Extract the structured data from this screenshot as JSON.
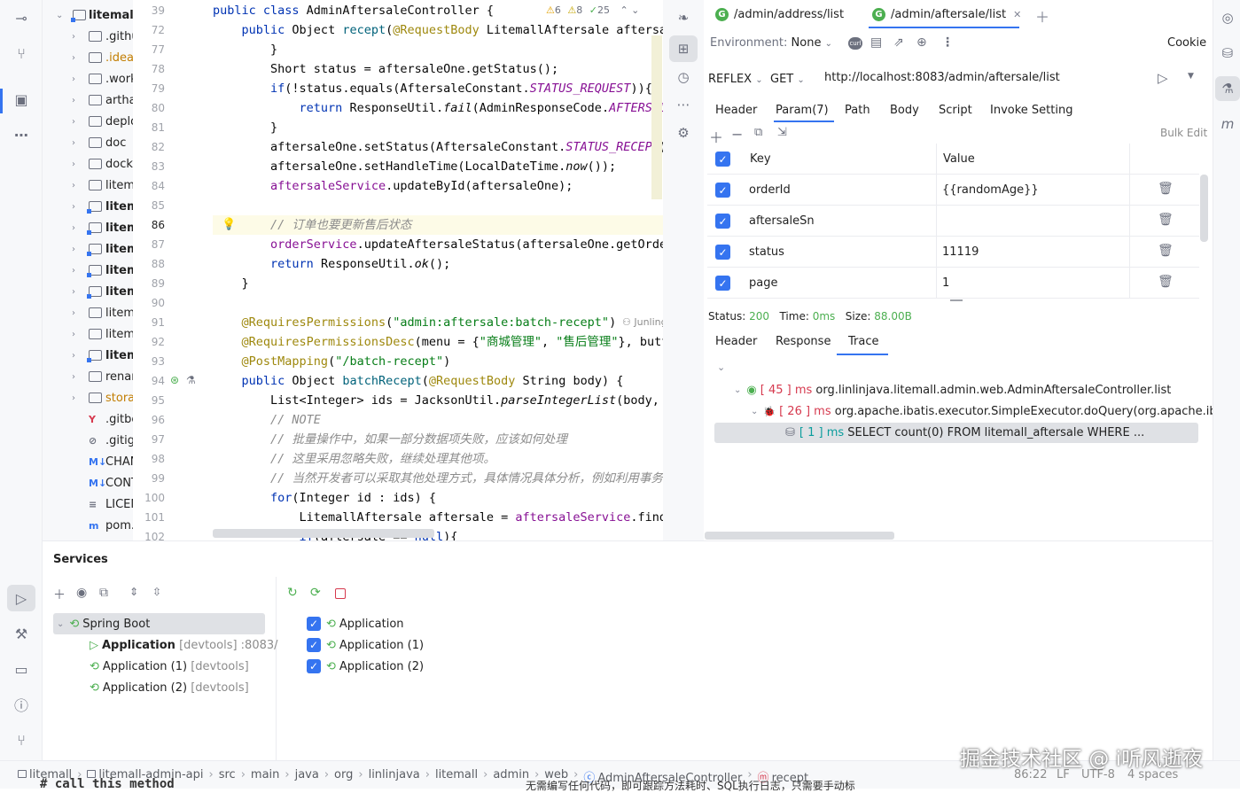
{
  "project_tree": {
    "root": "litemall",
    "items": [
      {
        "label": ".githu",
        "type": "folder",
        "mod": false,
        "bold": false
      },
      {
        "label": ".idea",
        "type": "folder",
        "mod": false,
        "bold": false,
        "color": "#c27d00"
      },
      {
        "label": ".work",
        "type": "folder",
        "mod": false,
        "bold": false
      },
      {
        "label": "artha",
        "type": "folder",
        "mod": false,
        "bold": false
      },
      {
        "label": "deplo",
        "type": "folder",
        "mod": false,
        "bold": false
      },
      {
        "label": "doc",
        "type": "folder",
        "mod": false,
        "bold": false
      },
      {
        "label": "dock",
        "type": "folder",
        "mod": false,
        "bold": false
      },
      {
        "label": "litem",
        "type": "folder",
        "mod": false,
        "bold": false
      },
      {
        "label": "litem",
        "type": "folder",
        "mod": true,
        "bold": true
      },
      {
        "label": "litem",
        "type": "folder",
        "mod": true,
        "bold": true
      },
      {
        "label": "litem",
        "type": "folder",
        "mod": true,
        "bold": true
      },
      {
        "label": "litem",
        "type": "folder",
        "mod": true,
        "bold": true
      },
      {
        "label": "litem",
        "type": "folder",
        "mod": true,
        "bold": true
      },
      {
        "label": "litem",
        "type": "folder",
        "mod": false,
        "bold": false
      },
      {
        "label": "litem",
        "type": "folder",
        "mod": false,
        "bold": false
      },
      {
        "label": "litem",
        "type": "folder",
        "mod": true,
        "bold": true
      },
      {
        "label": "renar",
        "type": "folder",
        "mod": false,
        "bold": false
      },
      {
        "label": "stora",
        "type": "folder",
        "mod": false,
        "bold": false,
        "color": "#c27d00"
      },
      {
        "label": ".gitbc",
        "type": "file",
        "icon": "Y",
        "iconcolor": "#d6394e"
      },
      {
        "label": ".gitig",
        "type": "file",
        "icon": "⊘",
        "iconcolor": "#6c707e"
      },
      {
        "label": "CHAN",
        "type": "file",
        "icon": "M↓",
        "iconcolor": "#3574f0"
      },
      {
        "label": "CONT",
        "type": "file",
        "icon": "M↓",
        "iconcolor": "#3574f0"
      },
      {
        "label": "LICEN",
        "type": "file",
        "icon": "≡",
        "iconcolor": "#6c707e"
      },
      {
        "label": "pom.",
        "type": "file",
        "icon": "m",
        "iconcolor": "#3574f0"
      }
    ]
  },
  "editor": {
    "inspection": {
      "warnings": "6",
      "weak": "8",
      "ok": "25"
    },
    "lines": [
      {
        "n": "39",
        "html": "<span class='kw'>public class</span> AdminAftersaleController {"
      },
      {
        "n": "72",
        "html": "    <span class='kw'>public</span> Object <span class='meth'>recept</span>(<span class='ann'>@RequestBody</span> LitemallAftersale aftersa"
      },
      {
        "n": "77",
        "html": "        }"
      },
      {
        "n": "78",
        "html": "        Short status = aftersaleOne.getStatus();"
      },
      {
        "n": "79",
        "html": "        <span class='kw'>if</span>(!status.equals(AftersaleConstant.<span class='fld it'>STATUS_REQUEST</span>)){"
      },
      {
        "n": "80",
        "html": "            <span class='kw'>return</span> ResponseUtil.<span class='it'>fail</span>(AdminResponseCode.<span class='fld it'>AFTERSALE</span>"
      },
      {
        "n": "81",
        "html": "        }"
      },
      {
        "n": "82",
        "html": "        aftersaleOne.setStatus(AftersaleConstant.<span class='fld it'>STATUS_RECEPT</span>)"
      },
      {
        "n": "83",
        "html": "        aftersaleOne.setHandleTime(LocalDateTime.<span class='it'>now</span>());"
      },
      {
        "n": "84",
        "html": "        <span class='fld'>aftersaleService</span>.updateById(aftersaleOne);"
      },
      {
        "n": "85",
        "html": ""
      },
      {
        "n": "86",
        "html": "        <span class='cm'>// 订单也要更新售后状态</span>"
      },
      {
        "n": "87",
        "html": "        <span class='fld'>orderService</span>.updateAftersaleStatus(aftersaleOne.getOrder"
      },
      {
        "n": "88",
        "html": "        <span class='kw'>return</span> ResponseUtil.<span class='it'>ok</span>();"
      },
      {
        "n": "89",
        "html": "    }"
      },
      {
        "n": "90",
        "html": ""
      },
      {
        "n": "91",
        "html": "    <span class='ann'>@RequiresPermissions</span>(<span class='str'>\"admin:aftersale:batch-recept\"</span>)"
      },
      {
        "n": "92",
        "html": "    <span class='ann'>@RequiresPermissionsDesc</span>(menu = {<span class='str'>\"商城管理\"</span>, <span class='str'>\"售后管理\"</span>}, butto"
      },
      {
        "n": "93",
        "html": "    <span class='ann'>@PostMapping</span>(<span class='str'>\"/batch-recept\"</span>)"
      },
      {
        "n": "94",
        "html": "    <span class='kw'>public</span> Object <span class='meth'>batchRecept</span>(<span class='ann'>@RequestBody</span> String body) {"
      },
      {
        "n": "95",
        "html": "        List&lt;Integer&gt; ids = JacksonUtil.<span class='it'>parseIntegerList</span>(body,"
      },
      {
        "n": "96",
        "html": "        <span class='cm'>// NOTE</span>"
      },
      {
        "n": "97",
        "html": "        <span class='cm'>// 批量操作中，如果一部分数据项失败，应该如何处理</span>"
      },
      {
        "n": "98",
        "html": "        <span class='cm'>// 这里采用忽略失败，继续处理其他项。</span>"
      },
      {
        "n": "99",
        "html": "        <span class='cm'>// 当然开发者可以采取其他处理方式，具体情况具体分析，例如利用事务回</span>"
      },
      {
        "n": "100",
        "html": "        <span class='kw'>for</span>(Integer id : ids) {"
      },
      {
        "n": "101",
        "html": "            LitemallAftersale aftersale = <span class='fld'>aftersaleService</span>.findB"
      },
      {
        "n": "102",
        "html": "            <span class='kw'>if</span>(aftersale == <span class='kw'>null</span>){"
      }
    ],
    "author_hint": "Junling"
  },
  "tabs": [
    {
      "label": "/admin/address/list",
      "active": false
    },
    {
      "label": "/admin/aftersale/list",
      "active": true
    }
  ],
  "environment": {
    "label": "Environment:",
    "value": "None",
    "cookie": "Cookie"
  },
  "request": {
    "project": "REFLEX",
    "method": "GET",
    "url": "http://localhost:8083/admin/aftersale/list"
  },
  "request_tabs": [
    "Header",
    "Param(7)",
    "Path",
    "Body",
    "Script",
    "Invoke Setting"
  ],
  "bulk_edit": "Bulk Edit",
  "params": {
    "headers": {
      "key": "Key",
      "value": "Value"
    },
    "rows": [
      {
        "key": "orderId",
        "value": "{{randomAge}}"
      },
      {
        "key": "aftersaleSn",
        "value": ""
      },
      {
        "key": "status",
        "value": "11119"
      },
      {
        "key": "page",
        "value": "1"
      }
    ]
  },
  "response_status": {
    "status_label": "Status:",
    "status": "200",
    "time_label": "Time:",
    "time": "0ms",
    "size_label": "Size:",
    "size": "88.00B"
  },
  "response_tabs": [
    "Header",
    "Response",
    "Trace"
  ],
  "trace": [
    {
      "ms": "[ 45 ] ms",
      "text": "org.linlinjava.litemall.admin.web.AdminAftersaleController.list"
    },
    {
      "ms": "[ 26 ] ms",
      "text": "org.apache.ibatis.executor.SimpleExecutor.doQuery(org.apache.ibatis.ma"
    },
    {
      "ms": "[ 1 ] ms",
      "text": "SELECT   count(0) FROM   litemall_aftersale WHERE ..."
    }
  ],
  "services": {
    "title": "Services",
    "tree": [
      {
        "label": "Spring Boot",
        "extra": ""
      },
      {
        "label": "Application",
        "extra": "[devtools] :8083/"
      },
      {
        "label": "Application (1)",
        "extra": "[devtools]"
      },
      {
        "label": "Application (2)",
        "extra": "[devtools]"
      }
    ],
    "checked": [
      "Application",
      "Application (1)",
      "Application (2)"
    ]
  },
  "breadcrumb": [
    "litemall",
    "litemall-admin-api",
    "src",
    "main",
    "java",
    "org",
    "linlinjava",
    "litemall",
    "admin",
    "web",
    "AdminAftersaleController",
    "recept"
  ],
  "status": {
    "position": "86:22",
    "line_ending": "LF",
    "encoding": "UTF-8",
    "indent": "4 spaces"
  },
  "watermark": "掘金技术社区 @ i听风逝夜",
  "bottom_text": {
    "left": "# call this method",
    "right": "无需编写任何代码，即可跟踪方法耗时、SQL执行日志，只需要手动标"
  }
}
